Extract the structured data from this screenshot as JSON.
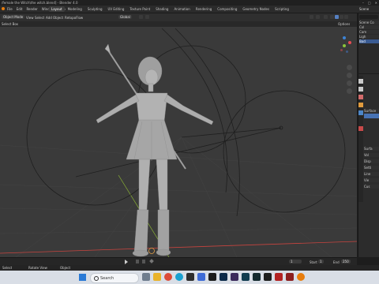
{
  "window": {
    "title": "/female the Witch\\the witch.blend] - Blender 4.0",
    "controls": [
      "–",
      "□",
      "✕"
    ]
  },
  "menu": [
    "File",
    "Edit",
    "Render",
    "Window",
    "Help"
  ],
  "workspaces": [
    "Layout",
    "Modeling",
    "Sculpting",
    "UV Editing",
    "Texture Paint",
    "Shading",
    "Animation",
    "Rendering",
    "Compositing",
    "Geometry Nodes",
    "Scripting"
  ],
  "scene": {
    "name": "Scene"
  },
  "viewport_header": {
    "mode": "Object Mode",
    "view": "View",
    "select": "Select",
    "add": "Add",
    "object": "Object",
    "retopo": "RetopoFlow",
    "transform": "Global",
    "options": "Options"
  },
  "viewport_header2": {
    "select_box": "Select Box"
  },
  "timeline": {
    "frame_current": "1",
    "start_label": "Start",
    "start": "1",
    "end_label": "End",
    "end": "250"
  },
  "status": {
    "left": "Select",
    "mid": "Rotate View",
    "right": "Object"
  },
  "properties": {
    "items": [
      "Surfa",
      "Vol",
      "Disp",
      "Setti",
      "Line",
      "Vie",
      "Cus"
    ],
    "header": "Surface"
  },
  "outliner": {
    "title": "Scene Collection",
    "items": [
      "Scene Co",
      "Col",
      "Cam",
      "Ligh",
      "Bod"
    ]
  },
  "taskbar": {
    "search_placeholder": "Search",
    "time": "",
    "date": ""
  },
  "colors": {
    "accent": "#4772b3",
    "viewport_bg": "#3a3a3a",
    "x_axis": "#c8443f",
    "y_axis": "#8ab334",
    "circle": "#1f1f1f"
  }
}
